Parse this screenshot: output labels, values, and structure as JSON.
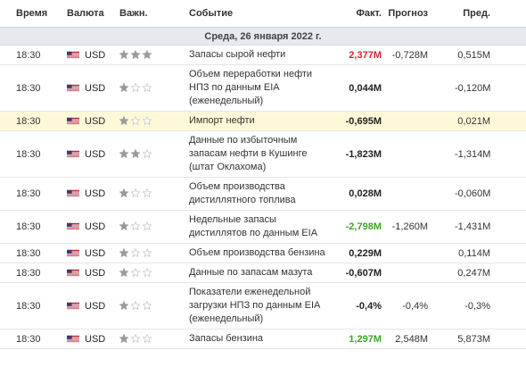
{
  "header": {
    "time": "Время",
    "currency": "Валюта",
    "importance": "Важн.",
    "event": "Событие",
    "actual": "Факт.",
    "forecast": "Прогноз",
    "previous": "Пред."
  },
  "date_label": "Среда, 26 января 2022 г.",
  "colors": {
    "negative": "#d9232e",
    "positive": "#3ea526",
    "highlight_row": "#fdf9d8",
    "star_filled": "#9a9a9a",
    "star_empty": "#c8c8c8"
  },
  "rows": [
    {
      "time": "18:30",
      "currency": "USD",
      "stars": 3,
      "event": "Запасы сырой нефти",
      "actual": "2,377M",
      "actual_color": "neg",
      "forecast": "-0,728M",
      "previous": "0,515M",
      "highlight": false
    },
    {
      "time": "18:30",
      "currency": "USD",
      "stars": 1,
      "event": "Объем переработки нефти НПЗ по данным EIA (еженедельный)",
      "actual": "0,044M",
      "actual_color": "neu",
      "forecast": "",
      "previous": "-0,120M",
      "highlight": false
    },
    {
      "time": "18:30",
      "currency": "USD",
      "stars": 1,
      "event": "Импорт нефти",
      "actual": "-0,695M",
      "actual_color": "neu",
      "forecast": "",
      "previous": "0,021M",
      "highlight": true
    },
    {
      "time": "18:30",
      "currency": "USD",
      "stars": 2,
      "event": "Данные по избыточным запасам нефти в Кушинге (штат Оклахома)",
      "actual": "-1,823M",
      "actual_color": "neu",
      "forecast": "",
      "previous": "-1,314M",
      "highlight": false
    },
    {
      "time": "18:30",
      "currency": "USD",
      "stars": 1,
      "event": "Объем производства дистиллятного топлива",
      "actual": "0,028M",
      "actual_color": "neu",
      "forecast": "",
      "previous": "-0,060M",
      "highlight": false
    },
    {
      "time": "18:30",
      "currency": "USD",
      "stars": 1,
      "event": "Недельные запасы дистиллятов по данным EIA",
      "actual": "-2,798M",
      "actual_color": "pos",
      "forecast": "-1,260M",
      "previous": "-1,431M",
      "highlight": false
    },
    {
      "time": "18:30",
      "currency": "USD",
      "stars": 1,
      "event": "Объем производства бензина",
      "actual": "0,229M",
      "actual_color": "neu",
      "forecast": "",
      "previous": "0,114M",
      "highlight": false
    },
    {
      "time": "18:30",
      "currency": "USD",
      "stars": 1,
      "event": "Данные по запасам мазута",
      "actual": "-0,607M",
      "actual_color": "neu",
      "forecast": "",
      "previous": "0,247M",
      "highlight": false
    },
    {
      "time": "18:30",
      "currency": "USD",
      "stars": 1,
      "event": "Показатели еженедельной загрузки НПЗ по данным EIA (еженедельный)",
      "actual": "-0,4%",
      "actual_color": "neu",
      "forecast": "-0,4%",
      "previous": "-0,3%",
      "highlight": false
    },
    {
      "time": "18:30",
      "currency": "USD",
      "stars": 1,
      "event": "Запасы бензина",
      "actual": "1,297M",
      "actual_color": "pos",
      "forecast": "2,548M",
      "previous": "5,873M",
      "highlight": false
    }
  ]
}
